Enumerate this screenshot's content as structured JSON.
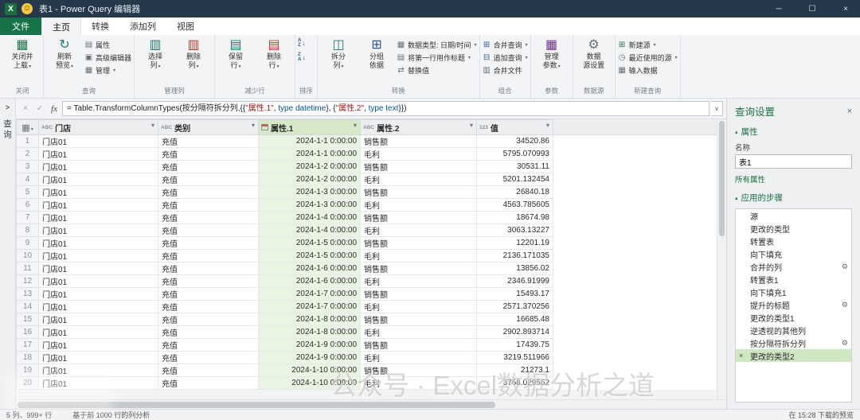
{
  "window": {
    "title": "表1 - Power Query 编辑器"
  },
  "menu": {
    "tabs": [
      "文件",
      "主页",
      "转换",
      "添加列",
      "视图"
    ]
  },
  "ribbon": {
    "group_labels": [
      "关闭",
      "查询",
      "管理列",
      "减少行",
      "排序",
      "转换",
      "组合",
      "参数",
      "数据源",
      "新建查询"
    ],
    "close_load": {
      "l1": "关闭并",
      "l2": "上载"
    },
    "refresh": {
      "l1": "刷新",
      "l2": "预览"
    },
    "properties": "属性",
    "advanced_editor": "高级编辑器",
    "manage": "管理",
    "choose_columns": {
      "l1": "选择",
      "l2": "列"
    },
    "remove_columns": {
      "l1": "删除",
      "l2": "列"
    },
    "keep_rows": {
      "l1": "保留",
      "l2": "行"
    },
    "remove_rows": {
      "l1": "删除",
      "l2": "行"
    },
    "split_column": {
      "l1": "拆分",
      "l2": "列"
    },
    "group_by": {
      "l1": "分组",
      "l2": "依据"
    },
    "data_type": "数据类型: 日期/时间",
    "first_row_headers": "将第一行用作标题",
    "replace_values": "替换值",
    "merge_queries": "合并查询",
    "append_queries": "追加查询",
    "combine_files": "合并文件",
    "manage_parameters": {
      "l1": "管理",
      "l2": "参数"
    },
    "datasource_settings": {
      "l1": "数据",
      "l2": "源设置"
    },
    "new_source": "新建源",
    "recent_sources": "最近使用的源",
    "enter_data": "输入数据"
  },
  "ribbon_icons": {
    "close_load": "▦",
    "refresh": "↻",
    "properties": "▤",
    "advanced_editor": "▣",
    "manage": "▦",
    "choose_columns": "▥",
    "remove_columns": "▥",
    "keep_rows": "▤",
    "remove_rows": "▤",
    "split_column": "◫",
    "group_by": "⊞",
    "data_type": "▦",
    "first_row_headers": "▤",
    "replace_values": "⇄",
    "merge_queries": "⊞",
    "append_queries": "⊟",
    "combine_files": "▥",
    "manage_parameters": "▦",
    "datasource_settings": "⚙",
    "new_source": "⊞",
    "recent_sources": "◷",
    "enter_data": "▦",
    "corner": "▦"
  },
  "icons": {
    "excel": "X",
    "smiley": "☺",
    "minimize": "─",
    "maximize": "☐",
    "close": "×",
    "cancel": "×",
    "commit": "✓",
    "fx": "fx",
    "expand_formula": "∨",
    "chevron_right": ">",
    "dropdown": "▾",
    "collapse": "▴",
    "gear": "⚙",
    "delete_step": "×",
    "sort_a": "A",
    "sort_z": "Z",
    "sort_arrow": "↓"
  },
  "formula_bar": {
    "segments": [
      {
        "t": "= Table.TransformColumnTypes(按分隔符拆分列,{{",
        "c": "#1c1c1c"
      },
      {
        "t": "\"属性.1\"",
        "c": "#a31515"
      },
      {
        "t": ", ",
        "c": "#1c1c1c"
      },
      {
        "t": "type datetime",
        "c": "#0451a5"
      },
      {
        "t": "}, {",
        "c": "#1c1c1c"
      },
      {
        "t": "\"属性.2\"",
        "c": "#a31515"
      },
      {
        "t": ", ",
        "c": "#1c1c1c"
      },
      {
        "t": "type text",
        "c": "#0451a5"
      },
      {
        "t": "}})",
        "c": "#1c1c1c"
      }
    ]
  },
  "queries_pane": {
    "vertical_label": "查询"
  },
  "grid": {
    "columns": [
      {
        "name": "门店",
        "type": "text"
      },
      {
        "name": "类别",
        "type": "text"
      },
      {
        "name": "属性.1",
        "type": "datetime",
        "selected": true
      },
      {
        "name": "属性.2",
        "type": "text"
      },
      {
        "name": "值",
        "type": "number"
      }
    ],
    "rows": [
      [
        "门店01",
        "充值",
        "2024-1-1 0:00:00",
        "销售额",
        "34520.86"
      ],
      [
        "门店01",
        "充值",
        "2024-1-1 0:00:00",
        "毛利",
        "5795.070993"
      ],
      [
        "门店01",
        "充值",
        "2024-1-2 0:00:00",
        "销售额",
        "30531.11"
      ],
      [
        "门店01",
        "充值",
        "2024-1-2 0:00:00",
        "毛利",
        "5201.132454"
      ],
      [
        "门店01",
        "充值",
        "2024-1-3 0:00:00",
        "销售额",
        "26840.18"
      ],
      [
        "门店01",
        "充值",
        "2024-1-3 0:00:00",
        "毛利",
        "4563.785605"
      ],
      [
        "门店01",
        "充值",
        "2024-1-4 0:00:00",
        "销售额",
        "18674.98"
      ],
      [
        "门店01",
        "充值",
        "2024-1-4 0:00:00",
        "毛利",
        "3063.13227"
      ],
      [
        "门店01",
        "充值",
        "2024-1-5 0:00:00",
        "销售额",
        "12201.19"
      ],
      [
        "门店01",
        "充值",
        "2024-1-5 0:00:00",
        "毛利",
        "2136.171035"
      ],
      [
        "门店01",
        "充值",
        "2024-1-6 0:00:00",
        "销售额",
        "13856.02"
      ],
      [
        "门店01",
        "充值",
        "2024-1-6 0:00:00",
        "毛利",
        "2346.91999"
      ],
      [
        "门店01",
        "充值",
        "2024-1-7 0:00:00",
        "销售额",
        "15493.17"
      ],
      [
        "门店01",
        "充值",
        "2024-1-7 0:00:00",
        "毛利",
        "2571.370256"
      ],
      [
        "门店01",
        "充值",
        "2024-1-8 0:00:00",
        "销售额",
        "16685.48"
      ],
      [
        "门店01",
        "充值",
        "2024-1-8 0:00:00",
        "毛利",
        "2902.893714"
      ],
      [
        "门店01",
        "充值",
        "2024-1-9 0:00:00",
        "销售额",
        "17439.75"
      ],
      [
        "门店01",
        "充值",
        "2024-1-9 0:00:00",
        "毛利",
        "3219.511966"
      ],
      [
        "门店01",
        "充值",
        "2024-1-10 0:00:00",
        "销售额",
        "21273.1"
      ],
      [
        "门店01",
        "充值",
        "2024-1-10 0:00:00",
        "毛利",
        "3768.029562"
      ]
    ]
  },
  "settings_panel": {
    "title": "查询设置",
    "properties_header": "属性",
    "name_label": "名称",
    "name_value": "表1",
    "all_properties_link": "所有属性",
    "steps_header": "应用的步骤",
    "steps": [
      {
        "label": "源"
      },
      {
        "label": "更改的类型"
      },
      {
        "label": "转置表"
      },
      {
        "label": "向下填充"
      },
      {
        "label": "合并的列",
        "gear": true
      },
      {
        "label": "转置表1"
      },
      {
        "label": "向下填充1"
      },
      {
        "label": "提升的标题",
        "gear": true
      },
      {
        "label": "更改的类型1"
      },
      {
        "label": "逆透视的其他列"
      },
      {
        "label": "按分隔符拆分列",
        "gear": true
      },
      {
        "label": "更改的类型2",
        "selected": true
      }
    ]
  },
  "status_bar": {
    "left1": "5 列、999+ 行",
    "left2": "基于前 1000 行的列分析",
    "right": "在 15:28 下载的预览"
  },
  "watermark": "公众号 · Excel数据分析之道"
}
